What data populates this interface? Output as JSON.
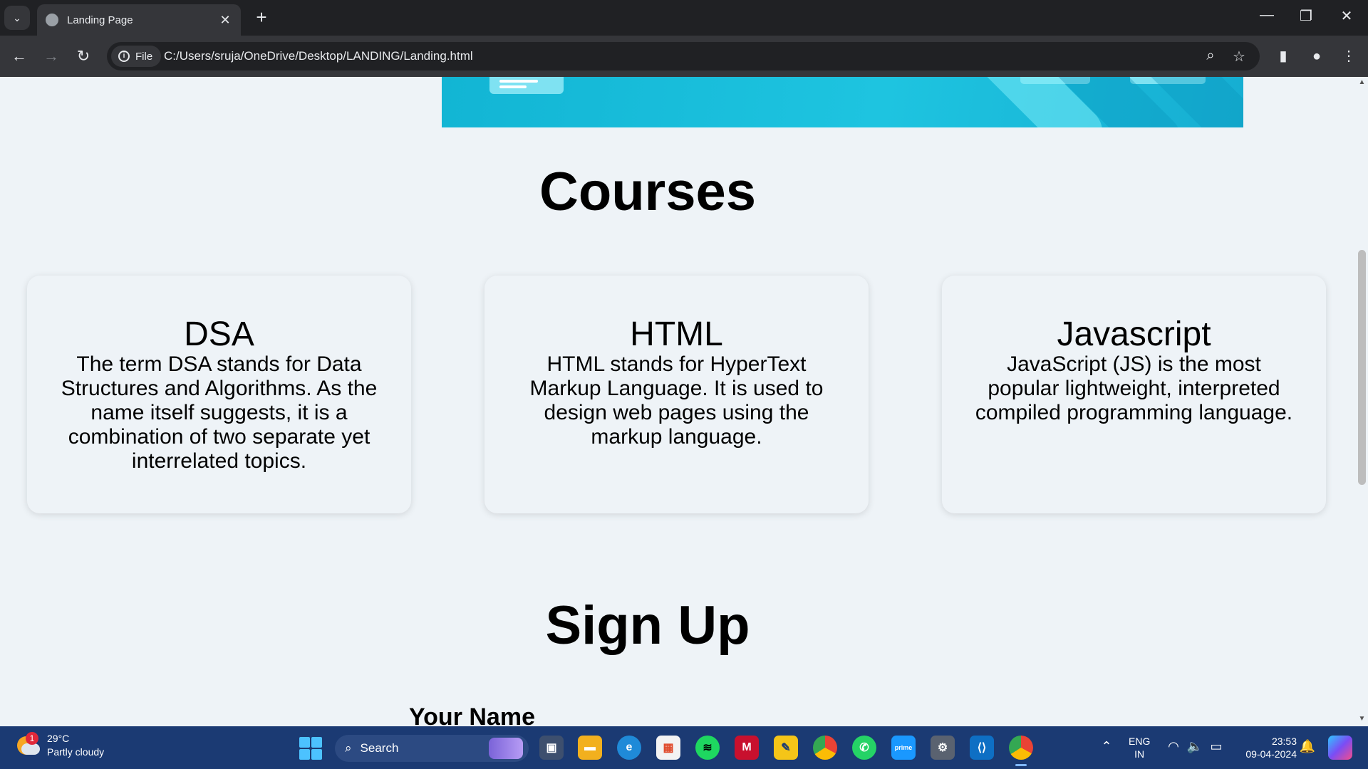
{
  "browser": {
    "tab_title": "Landing Page",
    "url_chip": "File",
    "url": "C:/Users/sruja/OneDrive/Desktop/LANDING/Landing.html"
  },
  "page": {
    "courses_title": "Courses",
    "courses": [
      {
        "title": "DSA",
        "description": "The term DSA stands for Data Structures and Algorithms. As the name itself suggests, it is a combination of two separate yet interrelated topics."
      },
      {
        "title": "HTML",
        "description": "HTML stands for HyperText Markup Language. It is used to design web pages using the markup language."
      },
      {
        "title": "Javascript",
        "description": "JavaScript (JS) is the most popular lightweight, interpreted compiled programming language."
      }
    ],
    "signup_title": "Sign Up",
    "name_label": "Your Name"
  },
  "taskbar": {
    "weather_temp": "29°C",
    "weather_desc": "Partly cloudy",
    "weather_badge": "1",
    "search_label": "Search",
    "lang_top": "ENG",
    "lang_bottom": "IN",
    "time": "23:53",
    "date": "09-04-2024"
  },
  "colors": {
    "page_bg": "#eef3f7",
    "hero_accent": "#1ec4e0",
    "taskbar_bg": "#1b3a73"
  }
}
